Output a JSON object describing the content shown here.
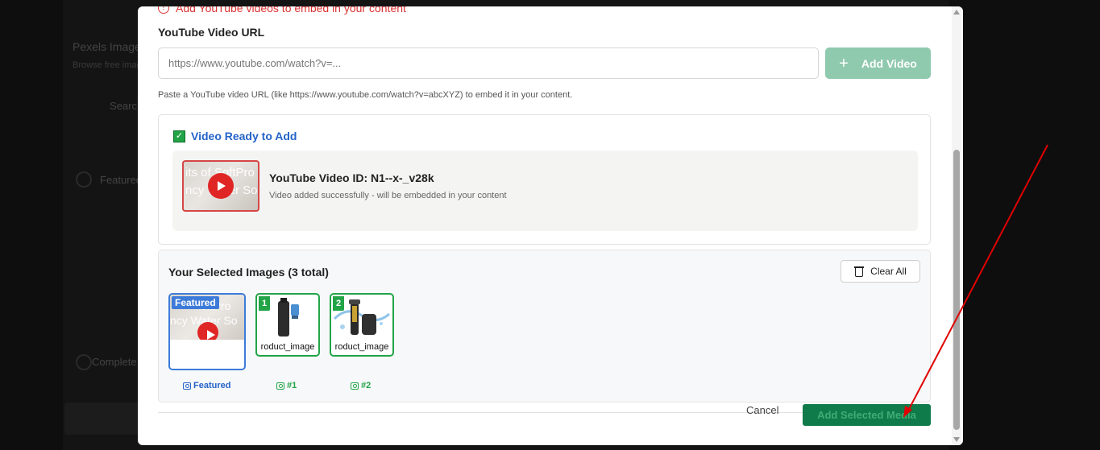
{
  "background": {
    "title": "Pexels Images",
    "subtitle": "Browse free images",
    "search_label": "Search",
    "featured_label": "Featured",
    "complete_label": "Complete"
  },
  "modal": {
    "error_text": "Add YouTube videos to embed in your content",
    "url_label": "YouTube Video URL",
    "url_placeholder": "https://www.youtube.com/watch?v=...",
    "add_video_label": "Add Video",
    "help_text": "Paste a YouTube video URL (like https://www.youtube.com/watch?v=abcXYZ) to embed it in your content.",
    "ready": {
      "title": "Video Ready to Add",
      "thumb_text_1": "its of SoftPro",
      "thumb_text_2": "ncy Water So",
      "video_id_label": "YouTube Video ID: N1--x-_v28k",
      "status": "Video added successfully - will be embedded in your content"
    },
    "selected": {
      "title": "Your Selected Images (3 total)",
      "clear_all_label": "Clear All",
      "items": [
        {
          "badge": "Featured",
          "thumb_text_1": "oftPro",
          "thumb_text_2": "ncy Water So",
          "label": "Featured"
        },
        {
          "badge": "1",
          "caption": "roduct_image",
          "label": "#1"
        },
        {
          "badge": "2",
          "caption": "roduct_image",
          "label": "#2"
        }
      ]
    },
    "footer": {
      "cancel_label": "Cancel",
      "submit_label": "Add Selected Media"
    }
  },
  "colors": {
    "accent_green": "#22a447",
    "accent_blue": "#3d7bd9",
    "error_red": "#d33",
    "arrow_red": "#e00000"
  },
  "icons": [
    "alert-circle-icon",
    "plus-icon",
    "check-icon",
    "play-icon",
    "trash-icon",
    "image-icon",
    "camera-icon"
  ]
}
